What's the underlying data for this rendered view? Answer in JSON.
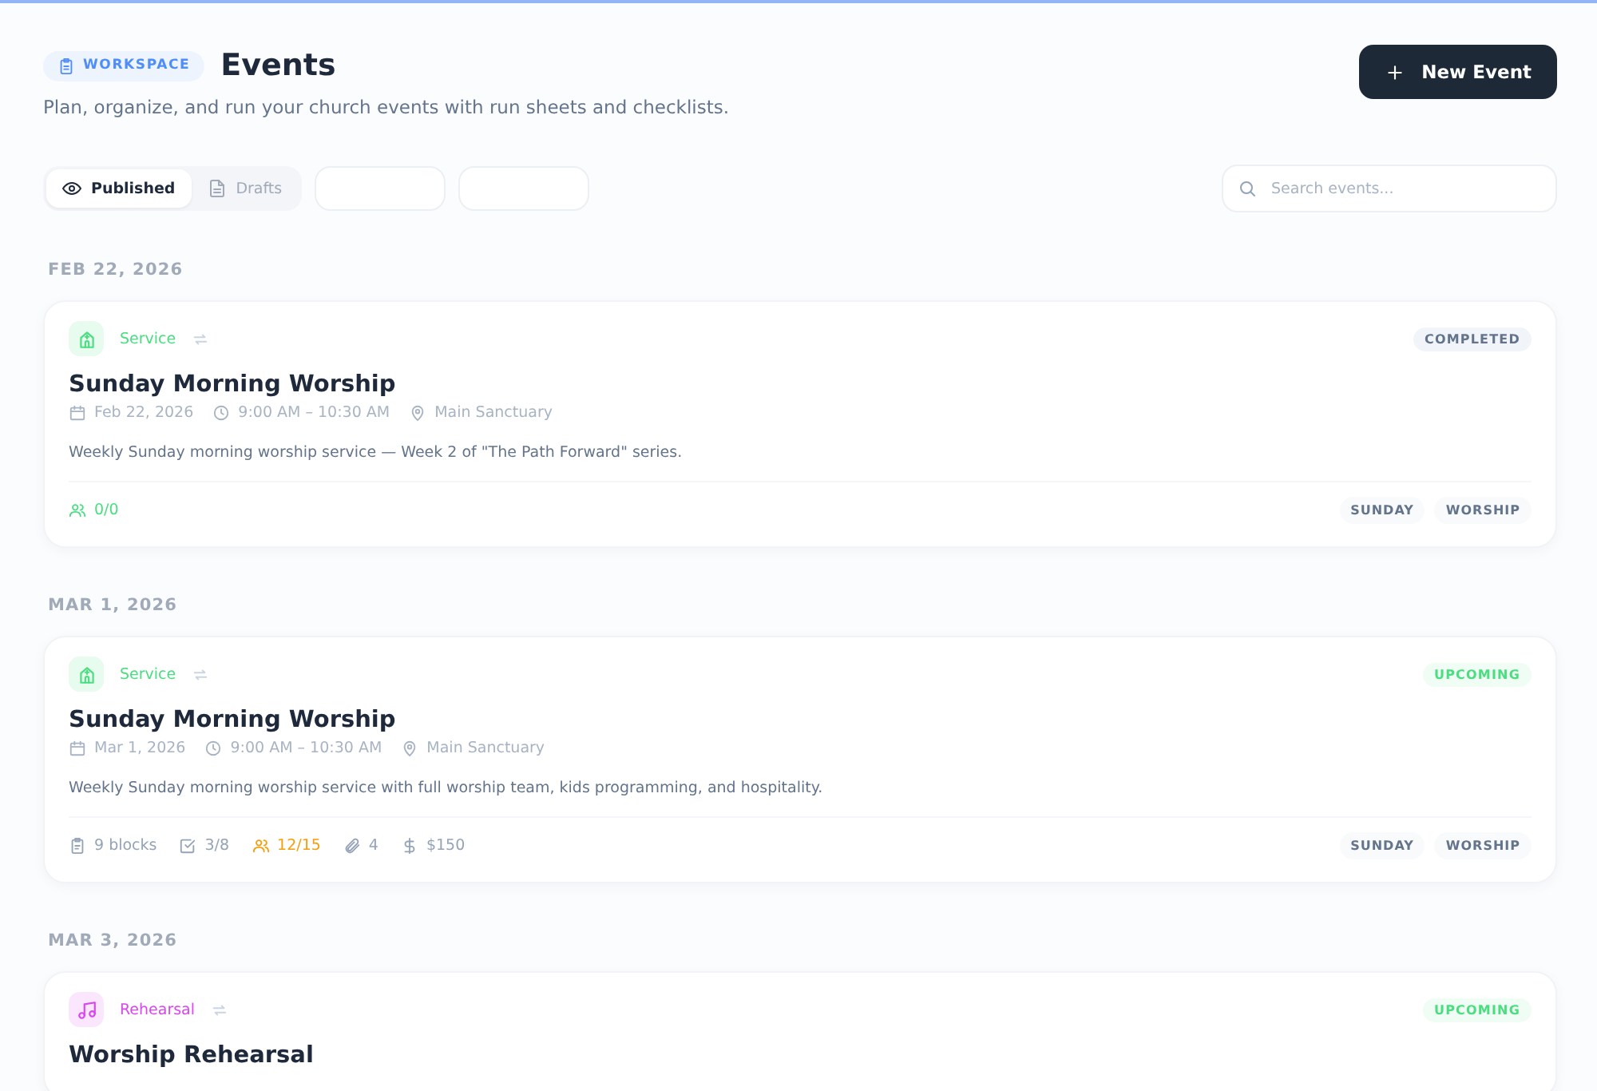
{
  "header": {
    "badge": "WORKSPACE",
    "title": "Events",
    "subtitle": "Plan, organize, and run your church events with run sheets and checklists.",
    "new_button": "New Event"
  },
  "filters": [
    {
      "label": "Published",
      "kind": "published",
      "selected": true
    },
    {
      "label": "Drafts",
      "kind": "drafts",
      "selected": false
    },
    {
      "kind": "empty",
      "selected": false
    },
    {
      "kind": "empty",
      "selected": false
    }
  ],
  "search": {
    "placeholder": "Search events..."
  },
  "groups": [
    {
      "date": "FEB 22, 2026",
      "events": [
        {
          "category": {
            "label": "Service",
            "kind": "service",
            "color": "#4ade80"
          },
          "recurring": true,
          "status": {
            "label": "COMPLETED",
            "kind": "completed"
          },
          "title": "Sunday Morning Worship",
          "date": "Feb 22, 2026",
          "time": "9:00 AM – 10:30 AM",
          "location": "Main Sanctuary",
          "description": "Weekly Sunday morning worship service — Week 2 of \"The Path Forward\" series.",
          "stats": [
            {
              "kind": "volunteers",
              "text": "0/0",
              "color": "#4ade80"
            }
          ],
          "tags": [
            "SUNDAY",
            "WORSHIP"
          ]
        }
      ]
    },
    {
      "date": "MAR 1, 2026",
      "events": [
        {
          "category": {
            "label": "Service",
            "kind": "service",
            "color": "#4ade80"
          },
          "recurring": true,
          "status": {
            "label": "UPCOMING",
            "kind": "upcoming"
          },
          "title": "Sunday Morning Worship",
          "date": "Mar 1, 2026",
          "time": "9:00 AM – 10:30 AM",
          "location": "Main Sanctuary",
          "description": "Weekly Sunday morning worship service with full worship team, kids programming, and hospitality.",
          "stats": [
            {
              "kind": "blocks",
              "text": "9 blocks",
              "color": "#94a3b8"
            },
            {
              "kind": "checklist",
              "text": "3/8",
              "color": "#94a3b8"
            },
            {
              "kind": "volunteers",
              "text": "12/15",
              "color": "#f59e0b"
            },
            {
              "kind": "attachments",
              "text": "4",
              "color": "#94a3b8"
            },
            {
              "kind": "budget",
              "text": "$150",
              "color": "#94a3b8"
            }
          ],
          "tags": [
            "SUNDAY",
            "WORSHIP"
          ]
        }
      ]
    },
    {
      "date": "MAR 3, 2026",
      "events": [
        {
          "category": {
            "label": "Rehearsal",
            "kind": "rehearsal",
            "color": "#d946ef"
          },
          "recurring": true,
          "status": {
            "label": "UPCOMING",
            "kind": "upcoming"
          },
          "title": "Worship Rehearsal"
        }
      ]
    }
  ]
}
